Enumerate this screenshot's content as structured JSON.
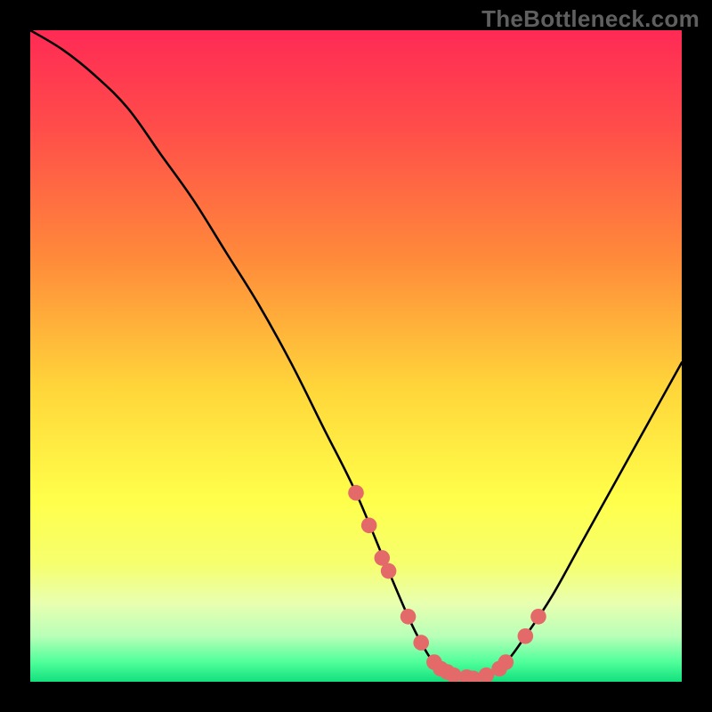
{
  "watermark": "TheBottleneck.com",
  "chart_data": {
    "type": "line",
    "title": "",
    "xlabel": "",
    "ylabel": "",
    "xlim": [
      0,
      100
    ],
    "ylim": [
      0,
      100
    ],
    "grid": false,
    "legend": false,
    "gradient_stops": [
      {
        "offset": 0.0,
        "color": "#ff2a55"
      },
      {
        "offset": 0.15,
        "color": "#ff4d4a"
      },
      {
        "offset": 0.35,
        "color": "#ff8a3a"
      },
      {
        "offset": 0.55,
        "color": "#ffd63a"
      },
      {
        "offset": 0.72,
        "color": "#ffff4a"
      },
      {
        "offset": 0.82,
        "color": "#f6ff6e"
      },
      {
        "offset": 0.88,
        "color": "#e8ffb0"
      },
      {
        "offset": 0.93,
        "color": "#b8ffb8"
      },
      {
        "offset": 0.97,
        "color": "#4fff9a"
      },
      {
        "offset": 1.0,
        "color": "#12e07e"
      }
    ],
    "series": [
      {
        "name": "bottleneck-curve",
        "x": [
          0,
          5,
          10,
          15,
          20,
          25,
          30,
          35,
          40,
          45,
          50,
          55,
          58,
          60,
          62,
          65,
          68,
          70,
          73,
          76,
          80,
          85,
          90,
          95,
          100
        ],
        "values": [
          100,
          97,
          93,
          88,
          81,
          74,
          66,
          58,
          49,
          39,
          29,
          17,
          10,
          6,
          3,
          1,
          0.5,
          1,
          3,
          7,
          13,
          22,
          31,
          40,
          49
        ]
      }
    ],
    "markers": {
      "name": "highlight-dots",
      "color": "#e46a6a",
      "radius": 1.2,
      "x": [
        50,
        52,
        54,
        55,
        58,
        60,
        62,
        63,
        64,
        65,
        67,
        68,
        70,
        72,
        73,
        76,
        78
      ],
      "values": [
        29,
        24,
        19,
        17,
        10,
        6,
        3,
        2,
        1.5,
        1,
        0.7,
        0.5,
        1,
        2,
        3,
        7,
        10
      ]
    }
  }
}
